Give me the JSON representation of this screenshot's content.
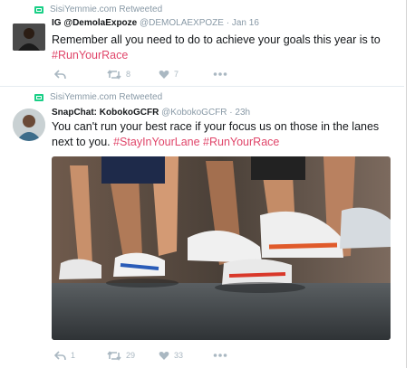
{
  "tweets": [
    {
      "retweeted_by": "SisiYemmie.com Retweeted",
      "display_name": "IG @DemolaExpoze",
      "handle": "@DEMOLAEXPOZE",
      "separator": "·",
      "time": "Jan 16",
      "text_plain": "Remember all you need to do to achieve your goals this year is to ",
      "hashtags": "#RunYourRace",
      "actions": {
        "reply_count": "",
        "retweet_count": "8",
        "like_count": "7"
      }
    },
    {
      "retweeted_by": "SisiYemmie.com Retweeted",
      "display_name": "SnapChat: KobokoGCFR",
      "handle": "@KobokoGCFR",
      "separator": "·",
      "time": "23h",
      "text_plain": "You can't run your best race if your focus us on those in the lanes next to you. ",
      "hashtags": "#StayInYourLane #RunYourRace",
      "media": "Photo of runners' legs and running shoes during a race",
      "actions": {
        "reply_count": "1",
        "retweet_count": "29",
        "like_count": "33"
      }
    }
  ],
  "colors": {
    "hashtag": "#e0466a",
    "retweet_green": "#19cf86",
    "muted": "#8899a6"
  },
  "icons": [
    "retweet-badge-icon",
    "reply-icon",
    "retweet-icon",
    "like-icon",
    "more-icon"
  ]
}
